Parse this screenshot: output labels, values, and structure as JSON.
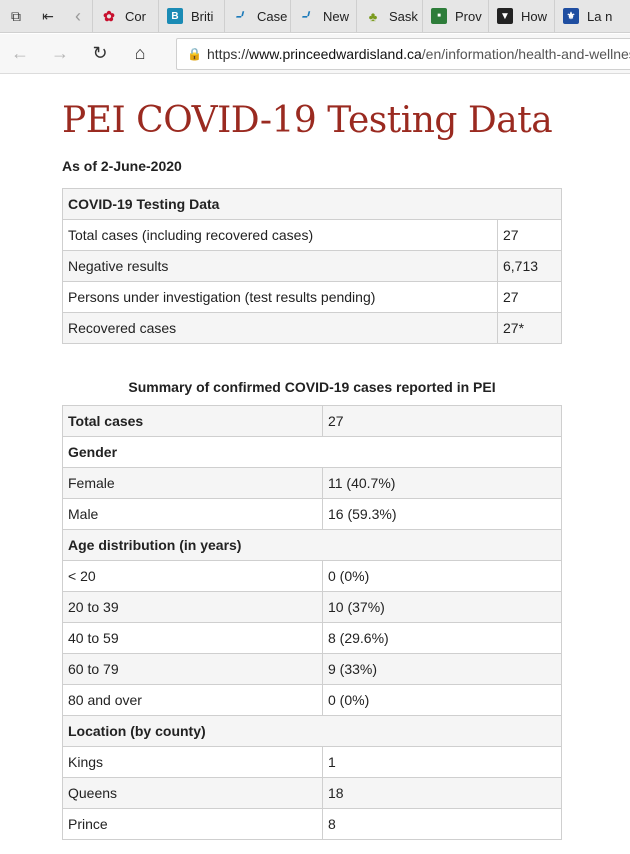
{
  "browser": {
    "tabs": [
      {
        "label": "Cor",
        "icon": "maple-leaf-icon"
      },
      {
        "label": "Briti",
        "icon": "bc-icon"
      },
      {
        "label": "Case",
        "icon": "alberta-icon"
      },
      {
        "label": "New",
        "icon": "alberta-icon"
      },
      {
        "label": "Sask",
        "icon": "saskatchewan-icon"
      },
      {
        "label": "Prov",
        "icon": "province-icon"
      },
      {
        "label": "How",
        "icon": "how-icon"
      },
      {
        "label": "La n",
        "icon": "quebec-icon"
      }
    ],
    "url_prefix": "https://",
    "url_domain": "www.princeedwardisland.ca",
    "url_path": "/en/information/health-and-wellness/"
  },
  "page": {
    "title": "PEI COVID-19 Testing Data",
    "as_of": "As of 2-June-2020"
  },
  "testing_table": {
    "header": "COVID-19 Testing Data",
    "rows": [
      {
        "label": "Total cases (including recovered cases)",
        "value": "27"
      },
      {
        "label": "Negative results",
        "value": "6,713"
      },
      {
        "label": "Persons under investigation (test results pending)",
        "value": "27"
      },
      {
        "label": "Recovered cases",
        "value": "27*"
      }
    ]
  },
  "summary": {
    "title": "Summary of confirmed COVID-19 cases reported in PEI",
    "total_label": "Total cases",
    "total_value": "27",
    "gender_header": "Gender",
    "gender": [
      {
        "label": "Female",
        "value": "11 (40.7%)"
      },
      {
        "label": "Male",
        "value": "16 (59.3%)"
      }
    ],
    "age_header": "Age distribution (in years)",
    "age": [
      {
        "label": "< 20",
        "value": "0 (0%)"
      },
      {
        "label": "20 to 39",
        "value": "10 (37%)"
      },
      {
        "label": "40 to 59",
        "value": "8 (29.6%)"
      },
      {
        "label": "60 to 79",
        "value": "9 (33%)"
      },
      {
        "label": "80 and over",
        "value": "0 (0%)"
      }
    ],
    "location_header": "Location (by county)",
    "location": [
      {
        "label": "Kings",
        "value": "1"
      },
      {
        "label": "Queens",
        "value": "18"
      },
      {
        "label": "Prince",
        "value": "8"
      }
    ]
  }
}
